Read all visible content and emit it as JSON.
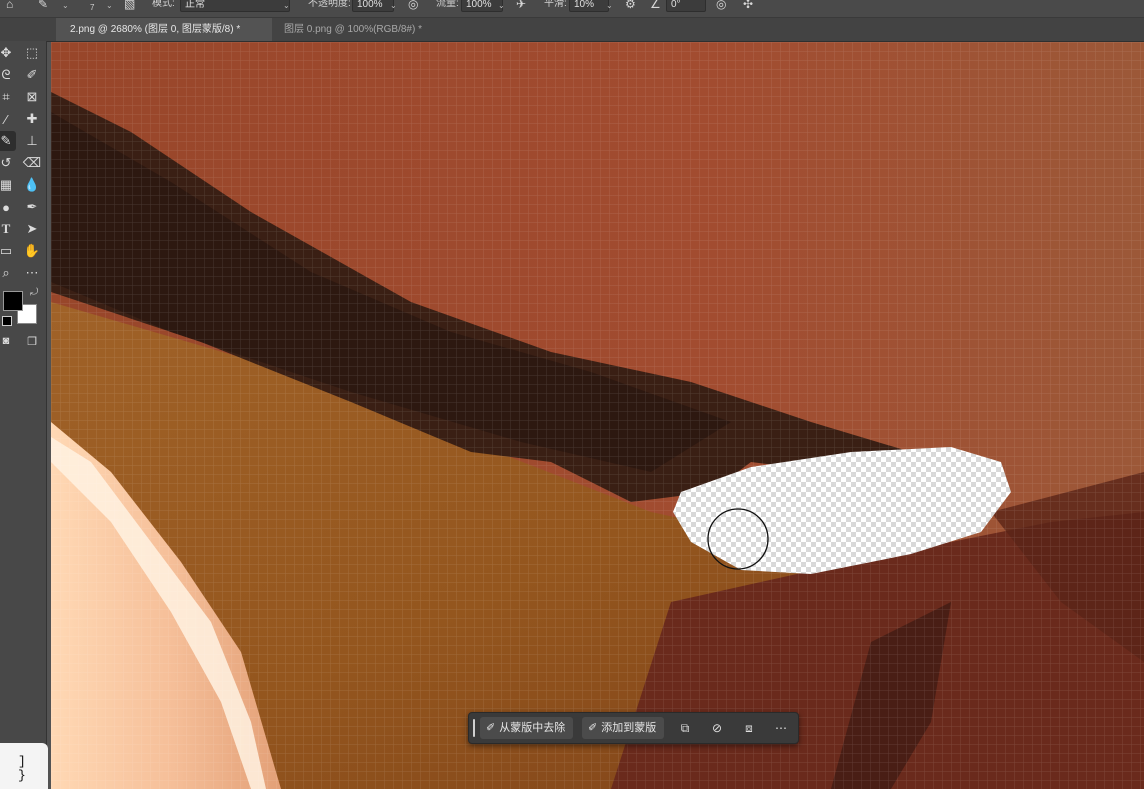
{
  "options_bar": {
    "mode_label": "模式:",
    "mode_value": "正常",
    "opacity_label": "不透明度:",
    "opacity_value": "100%",
    "flow_label": "流量:",
    "flow_value": "100%",
    "smoothing_label": "平滑:",
    "smoothing_value": "10%",
    "angle_value": "0°",
    "brush_size": "7"
  },
  "tabs": {
    "active": "2.png @ 2680% (图层 0, 图层蒙版/8) *",
    "inactive": "图层 0.png @ 100%(RGB/8#) *"
  },
  "context_bar": {
    "subtract_label": "从蒙版中去除",
    "add_label": "添加到蒙版"
  },
  "keycard": {
    "line1": "]",
    "line2": "}"
  },
  "colors": {
    "foreground": "#000000",
    "background": "#ffffff"
  }
}
